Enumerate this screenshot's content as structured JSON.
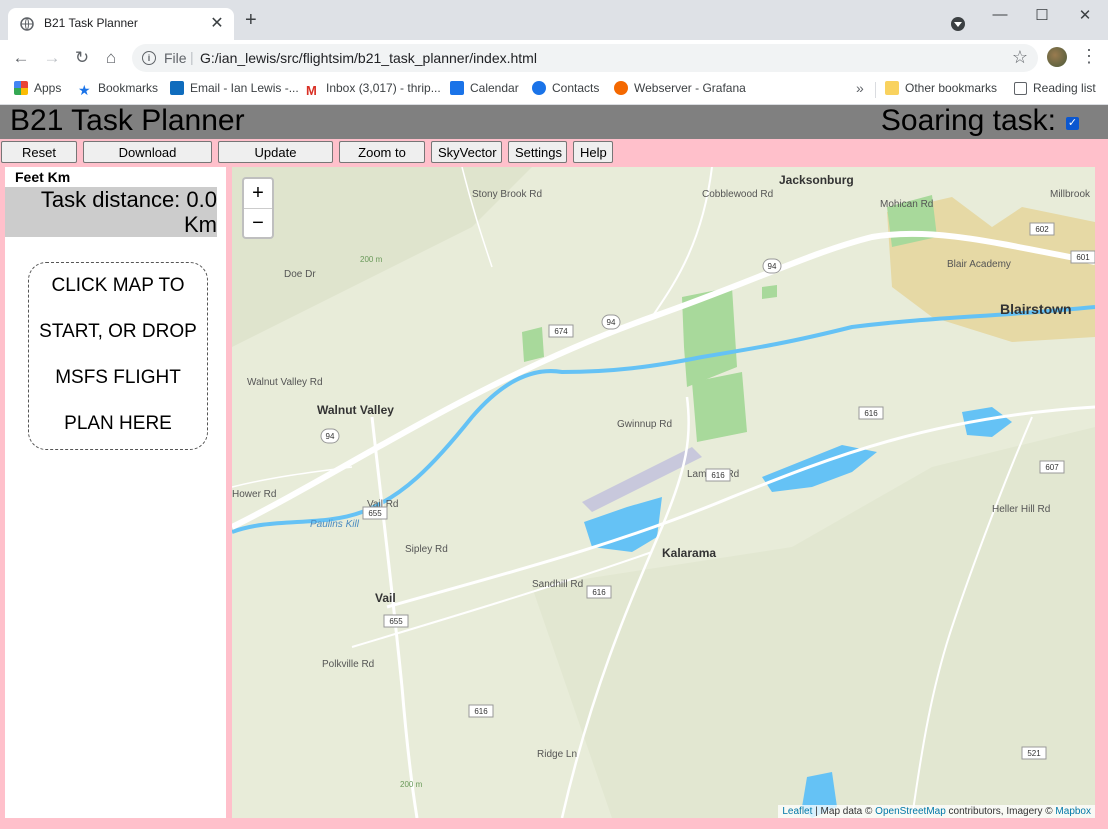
{
  "browser": {
    "tab_title": "B21 Task Planner",
    "tab_close": "✕",
    "new_tab": "+",
    "window_controls": {
      "minimize": "—",
      "maximize": "☐",
      "close": "✕"
    },
    "nav": {
      "back": "←",
      "forward": "→",
      "reload": "↻",
      "home": "⌂"
    },
    "omnibox": {
      "info": "i",
      "scheme_label": "File",
      "separator": "|",
      "url": "G:/ian_lewis/src/flightsim/b21_task_planner/index.html",
      "star": "☆"
    },
    "menu": "⋮",
    "bookmarks": [
      {
        "label": "Apps",
        "icon": "apps-grid-icon",
        "color": "#ea4335"
      },
      {
        "label": "Bookmarks",
        "icon": "star-icon",
        "color": "#1a73e8"
      },
      {
        "label": "Email - Ian Lewis -...",
        "icon": "outlook-icon",
        "color": "#0f6cbd"
      },
      {
        "label": "Inbox (3,017) - thrip...",
        "icon": "gmail-icon",
        "color": "#d93025"
      },
      {
        "label": "Calendar",
        "icon": "calendar-icon",
        "color": "#1a73e8"
      },
      {
        "label": "Contacts",
        "icon": "contacts-icon",
        "color": "#1a73e8"
      },
      {
        "label": "Webserver - Grafana",
        "icon": "grafana-icon",
        "color": "#f46800"
      }
    ],
    "bookmarks_more": "»",
    "other_bookmarks": "Other bookmarks",
    "reading_list": "Reading list"
  },
  "app": {
    "title": "B21 Task Planner",
    "soaring_label": "Soaring task:",
    "soaring_checked": true,
    "buttons": [
      "Reset Task",
      "Download FlightPlan",
      "Update elevations",
      "Zoom to task",
      "SkyVector",
      "Settings",
      "Help"
    ],
    "units": "Feet Km",
    "task_distance_label": "Task distance: 0.0",
    "task_distance_unit": "Km",
    "drop_lines": [
      "CLICK MAP TO",
      "START, OR DROP",
      "MSFS FLIGHT",
      "PLAN HERE"
    ]
  },
  "map": {
    "zoom_in": "+",
    "zoom_out": "−",
    "places": [
      "Jacksonburg",
      "Blairstown",
      "Blair Academy",
      "Walnut Valley",
      "Kalarama",
      "Vail"
    ],
    "roads": [
      "Cobblewood Rd",
      "Mohican Rd",
      "Millbrook",
      "Doe Dr",
      "Walnut Valley Rd",
      "Gwinnup Rd",
      "Lambert Rd",
      "Vail Rd",
      "Sipley Rd",
      "Sandhill Rd",
      "Polkville Rd",
      "Heller Hill Rd",
      "Ridge Ln",
      "Paulins Kill",
      "Stony Brook Rd",
      "Hower Rd"
    ],
    "route_shields": [
      "94",
      "674",
      "94",
      "94",
      "616",
      "616",
      "655",
      "616",
      "655",
      "616",
      "602",
      "601",
      "607",
      "521"
    ],
    "contours": [
      "200 m",
      "200 m"
    ],
    "attribution": {
      "leaflet": "Leaflet",
      "separator": " | ",
      "mapdata": "Map data © ",
      "osm": "OpenStreetMap",
      "contributors": " contributors, Imagery © ",
      "mapbox": "Mapbox"
    }
  },
  "colors": {
    "app_header": "#808080",
    "app_body": "#ffc0cb",
    "map_water": "#65c2f5",
    "map_land": "#e8ecd9",
    "map_park": "#a8d99b"
  }
}
